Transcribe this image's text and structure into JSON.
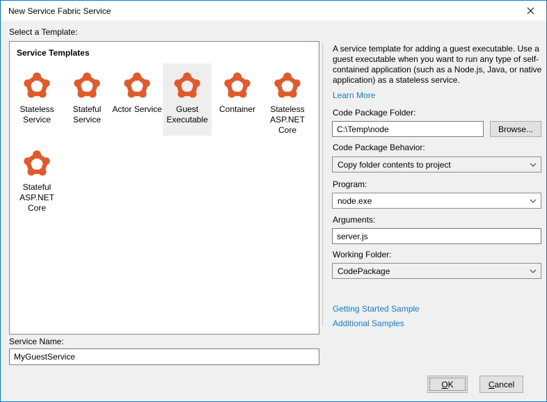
{
  "window": {
    "title": "New Service Fabric Service"
  },
  "icons": {
    "close-icon": "x-cross",
    "chevron-down-icon": "chevron-down",
    "service-fabric-icon": "pentagon-of-nodes"
  },
  "colors": {
    "accent_orange": "#e05a2b",
    "link_blue": "#0e7fd9",
    "window_border_blue": "#0078d7",
    "selected_tile_bg": "#eeeeee",
    "body_bg": "#f0f0f0"
  },
  "select_template_label": "Select a Template:",
  "templates": {
    "group_title": "Service Templates",
    "items": [
      {
        "id": "stateless-service",
        "lines": [
          "Stateless",
          "Service"
        ],
        "row": 1,
        "selected": false
      },
      {
        "id": "stateful-service",
        "lines": [
          "Stateful",
          "Service"
        ],
        "row": 1,
        "selected": false
      },
      {
        "id": "actor-service",
        "lines": [
          "Actor Service"
        ],
        "row": 1,
        "selected": false
      },
      {
        "id": "guest-executable",
        "lines": [
          "Guest",
          "Executable"
        ],
        "row": 1,
        "selected": true
      },
      {
        "id": "container",
        "lines": [
          "Container"
        ],
        "row": 1,
        "selected": false
      },
      {
        "id": "stateless-aspnet-core",
        "lines": [
          "Stateless",
          "ASP.NET",
          "Core"
        ],
        "row": 1,
        "selected": false
      },
      {
        "id": "stateful-aspnet-core",
        "lines": [
          "Stateful",
          "ASP.NET",
          "Core"
        ],
        "row": 2,
        "selected": false
      }
    ]
  },
  "details": {
    "description_lines": [
      "A service template for adding a guest executable. Use a",
      "guest executable when you want to run any type of self-",
      "contained application (such as a Node.js, Java, or native",
      "application) as a stateless service."
    ],
    "learn_more": "Learn More",
    "code_package_folder": {
      "label": "Code Package Folder:",
      "value": "C:\\Temp\\node",
      "browse_label": "Browse..."
    },
    "code_package_behavior": {
      "label": "Code Package Behavior:",
      "value": "Copy folder contents to project"
    },
    "program": {
      "label": "Program:",
      "value": "node.exe"
    },
    "arguments": {
      "label": "Arguments:",
      "value": "server.js"
    },
    "working_folder": {
      "label": "Working Folder:",
      "value": "CodePackage"
    },
    "links": [
      "Getting Started Sample",
      "Additional Samples"
    ]
  },
  "service_name": {
    "label": "Service Name:",
    "value": "MyGuestService"
  },
  "footer": {
    "ok_label": "OK",
    "cancel_label": "Cancel"
  }
}
